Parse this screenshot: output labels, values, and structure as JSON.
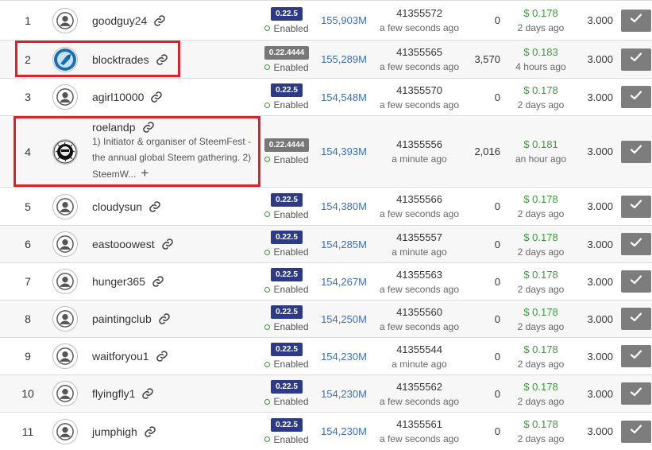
{
  "colors": {
    "enabled_dot": "#2ca02c",
    "badge_current": "#2d3b87",
    "badge_old": "#777777",
    "votes": "#3a6fc4",
    "price": "#3a9d3a",
    "highlight": "#d8232a"
  },
  "icons": {
    "link": "link-icon",
    "vote": "check-icon",
    "avatar": "user-icon"
  },
  "witnesses": [
    {
      "rank": "1",
      "name": "goodguy24",
      "version": "0.22.5",
      "status": "Enabled",
      "votes": "155,903M",
      "block": "41355572",
      "block_time": "a few seconds ago",
      "missed": "0",
      "price": "$ 0.178",
      "price_time": "2 days ago",
      "rate": "3.000"
    },
    {
      "rank": "2",
      "name": "blocktrades",
      "version": "0.22.4444",
      "status": "Enabled",
      "votes": "155,289M",
      "block": "41355565",
      "block_time": "a few seconds ago",
      "missed": "3,570",
      "price": "$ 0.183",
      "price_time": "4 hours ago",
      "rate": "3.000"
    },
    {
      "rank": "3",
      "name": "agirl10000",
      "version": "0.22.5",
      "status": "Enabled",
      "votes": "154,548M",
      "block": "41355570",
      "block_time": "a few seconds ago",
      "missed": "0",
      "price": "$ 0.178",
      "price_time": "2 days ago",
      "rate": "3.000"
    },
    {
      "rank": "4",
      "name": "roelandp",
      "desc": "1) Initiator & organiser of SteemFest - the annual global Steem gathering. 2) SteemW...",
      "version": "0.22.4444",
      "status": "Enabled",
      "votes": "154,393M",
      "block": "41355556",
      "block_time": "a minute ago",
      "missed": "2,016",
      "price": "$ 0.181",
      "price_time": "an hour ago",
      "rate": "3.000"
    },
    {
      "rank": "5",
      "name": "cloudysun",
      "version": "0.22.5",
      "status": "Enabled",
      "votes": "154,380M",
      "block": "41355566",
      "block_time": "a few seconds ago",
      "missed": "0",
      "price": "$ 0.178",
      "price_time": "2 days ago",
      "rate": "3.000"
    },
    {
      "rank": "6",
      "name": "eastooowest",
      "version": "0.22.5",
      "status": "Enabled",
      "votes": "154,285M",
      "block": "41355557",
      "block_time": "a minute ago",
      "missed": "0",
      "price": "$ 0.178",
      "price_time": "2 days ago",
      "rate": "3.000"
    },
    {
      "rank": "7",
      "name": "hunger365",
      "version": "0.22.5",
      "status": "Enabled",
      "votes": "154,267M",
      "block": "41355563",
      "block_time": "a few seconds ago",
      "missed": "0",
      "price": "$ 0.178",
      "price_time": "2 days ago",
      "rate": "3.000"
    },
    {
      "rank": "8",
      "name": "paintingclub",
      "version": "0.22.5",
      "status": "Enabled",
      "votes": "154,250M",
      "block": "41355560",
      "block_time": "a few seconds ago",
      "missed": "0",
      "price": "$ 0.178",
      "price_time": "2 days ago",
      "rate": "3.000"
    },
    {
      "rank": "9",
      "name": "waitforyou1",
      "version": "0.22.5",
      "status": "Enabled",
      "votes": "154,230M",
      "block": "41355544",
      "block_time": "a minute ago",
      "missed": "0",
      "price": "$ 0.178",
      "price_time": "2 days ago",
      "rate": "3.000"
    },
    {
      "rank": "10",
      "name": "flyingfly1",
      "version": "0.22.5",
      "status": "Enabled",
      "votes": "154,230M",
      "block": "41355562",
      "block_time": "a few seconds ago",
      "missed": "0",
      "price": "$ 0.178",
      "price_time": "2 days ago",
      "rate": "3.000"
    },
    {
      "rank": "11",
      "name": "jumphigh",
      "version": "0.22.5",
      "status": "Enabled",
      "votes": "154,230M",
      "block": "41355561",
      "block_time": "a few seconds ago",
      "missed": "0",
      "price": "$ 0.178",
      "price_time": "2 days ago",
      "rate": "3.000"
    }
  ]
}
